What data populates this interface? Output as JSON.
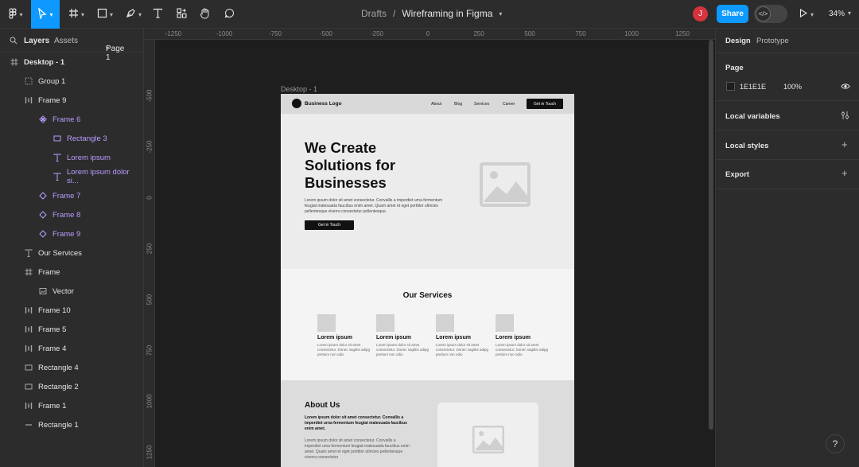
{
  "topbar": {
    "breadcrumb_parent": "Drafts",
    "separator": "/",
    "file_name": "Wireframing in Figma",
    "avatar_initial": "J",
    "share_label": "Share",
    "zoom": "34%",
    "accent": "#0d99ff"
  },
  "left_panel": {
    "tabs": [
      "Layers",
      "Assets"
    ],
    "page_select": "Page 1",
    "layers": [
      {
        "label": "Desktop - 1",
        "icon": "frame-icon",
        "indent": 0,
        "bold": true
      },
      {
        "label": "Group 1",
        "icon": "group-icon",
        "indent": 1
      },
      {
        "label": "Frame 9",
        "icon": "auto-layout-icon",
        "indent": 1
      },
      {
        "label": "Frame 6",
        "icon": "component-icon",
        "indent": 2,
        "purple": true
      },
      {
        "label": "Rectangle 3",
        "icon": "rectangle-icon",
        "indent": 3,
        "purple": true
      },
      {
        "label": "Lorem ipsum",
        "icon": "text-icon",
        "indent": 3,
        "purple": true
      },
      {
        "label": "Lorem ipsum dolor si...",
        "icon": "text-icon",
        "indent": 3,
        "purple": true
      },
      {
        "label": "Frame 7",
        "icon": "instance-icon",
        "indent": 2,
        "purple": true
      },
      {
        "label": "Frame 8",
        "icon": "instance-icon",
        "indent": 2,
        "purple": true
      },
      {
        "label": "Frame 9",
        "icon": "instance-icon",
        "indent": 2,
        "purple": true
      },
      {
        "label": "Our Services",
        "icon": "text-icon",
        "indent": 1
      },
      {
        "label": "Frame",
        "icon": "frame-icon",
        "indent": 1
      },
      {
        "label": "Vector",
        "icon": "image-icon",
        "indent": 2
      },
      {
        "label": "Frame 10",
        "icon": "auto-layout-icon",
        "indent": 1
      },
      {
        "label": "Frame 5",
        "icon": "auto-layout-icon",
        "indent": 1
      },
      {
        "label": "Frame 4",
        "icon": "auto-layout-icon",
        "indent": 1
      },
      {
        "label": "Rectangle 4",
        "icon": "rectangle-icon",
        "indent": 1
      },
      {
        "label": "Rectangle 2",
        "icon": "rectangle-icon",
        "indent": 1
      },
      {
        "label": "Frame 1",
        "icon": "auto-layout-icon",
        "indent": 1
      },
      {
        "label": "Rectangle 1",
        "icon": "line-icon",
        "indent": 1
      }
    ]
  },
  "rulers": {
    "horizontal": [
      "-1250",
      "-1000",
      "-750",
      "-500",
      "-250",
      "0",
      "250",
      "500",
      "750",
      "1000",
      "1250"
    ],
    "vertical": [
      "-500",
      "-250",
      "0",
      "250",
      "500",
      "750",
      "1000",
      "1250"
    ]
  },
  "right_panel": {
    "tabs": [
      "Design",
      "Prototype"
    ],
    "page_heading": "Page",
    "page_color": "1E1E1E",
    "page_opacity": "100%",
    "local_variables": "Local variables",
    "local_styles": "Local styles",
    "export": "Export"
  },
  "canvas": {
    "frame_label": "Desktop - 1",
    "nav": {
      "logo": "Business Logo",
      "links": [
        "About",
        "Blog",
        "Services",
        "Career"
      ],
      "cta": "Get in Touch"
    },
    "hero": {
      "title_lines": [
        "We Create",
        "Solutions for",
        "Businesses"
      ],
      "body": "Lorem ipsum dolor sit amet consectetur. Convallis a imperdiet urna fermentum feugiat malesuada faucibus enim amet. Quam amet et eget porttitor ultricies pellentesque viverra consectetur pellentesque.",
      "button": "Get in Touch"
    },
    "services": {
      "title": "Our Services",
      "items": [
        {
          "title": "Lorem ipsum",
          "desc": "Lorem ipsum dolor sit amet consectetur. Donec sagittis adipg pretium non odio"
        },
        {
          "title": "Lorem ipsum",
          "desc": "Lorem ipsum dolor sit amet consectetur. Donec sagittis adipg pretium non odio"
        },
        {
          "title": "Lorem ipsum",
          "desc": "Lorem ipsum dolor sit amet consectetur. Donec sagittis adipg pretium non odio"
        },
        {
          "title": "Lorem ipsum",
          "desc": "Lorem ipsum dolor sit amet consectetur. Donec sagittis adipg pretium non odio"
        }
      ]
    },
    "about": {
      "title": "About Us",
      "bold_text": "Lorem ipsum dolor sit amet consectetur. Convallis a imperdiet urna fermentum feugiat malesuada faucibus enim amet.",
      "body": "Lorem ipsum dolor sit amet consectetur. Convallis a imperdiet urna fermentum feugiat malesuada faucibus enim amet. Quam amet et eget porttitor ultricies pellentesque viverra consectetur"
    }
  },
  "help": "?"
}
